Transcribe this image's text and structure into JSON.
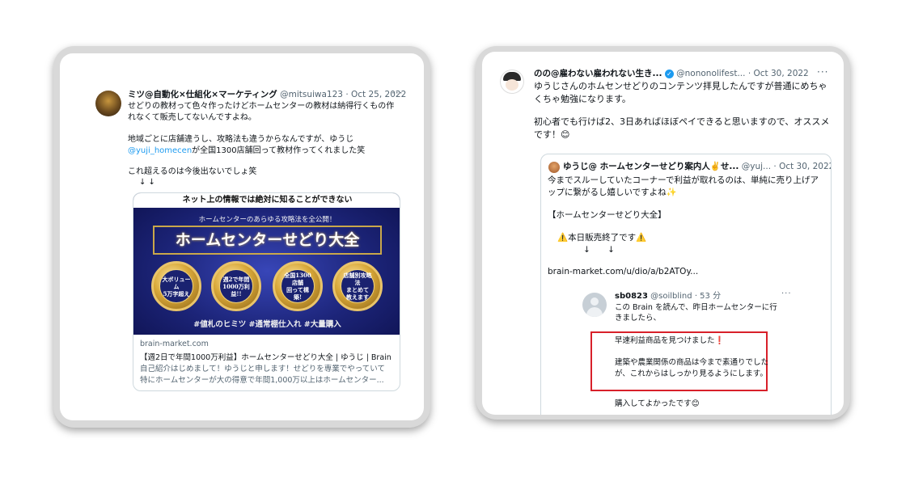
{
  "left_tweet": {
    "display_name": "ミツ@自動化×仕組化×マーケティング",
    "handle": "@mitsuiwa123",
    "date": "· Oct 25, 2022",
    "more": "···",
    "text_lines": [
      "せどりの教材って色々作ったけどホームセンターの教材は納得行くもの作",
      "れなくて販売してないんですよね。",
      "地域ごとに店舗違うし、攻略法も違うからなんですが、ゆうじ"
    ],
    "mention": "@yuji_homecen",
    "mention_rest": "が全国1300店舗回って教材作ってくれました笑",
    "text_after": "これ超えるのは今後出ないでしょ笑",
    "arrows": "↓ ↓",
    "link_card": {
      "banner_top": "ネット上の情報では絶対に知ることができない",
      "banner_sub": "ホームセンターのあらゆる攻略法を全公開！",
      "banner_title": "ホームセンターせどり大全",
      "medals": [
        "大ボリューム\n5万字超え",
        "週2で年間\n1000万利益!!",
        "全国1300店舗\n回って構築!",
        "店舗別攻略法\nまとめて\n教えます"
      ],
      "banner_bottom": "#値札のヒミツ  #通常棚仕入れ  #大量購入",
      "domain": "brain-market.com",
      "title": "【週2日で年間1000万利益】ホームセンターせどり大全 | ゆうじ | Brain",
      "desc_lines": [
        "自己紹介はじめまして！ゆうじと申します！せどりを専業でやっていて",
        "特にホームセンターが大の得意で年間1,000万以上はホームセンター..."
      ]
    }
  },
  "right_tweet": {
    "display_name": "のの@雇わない雇われない生き...",
    "handle": "@nononolifest...",
    "date": "· Oct 30, 2022",
    "more": "···",
    "text_lines": [
      "ゆうじさんのホムセンせどりのコンテンツ拝見したんですが普通にめちゃ",
      "くちゃ勉強になります。",
      "初心者でも行けば2、3日あればほぼペイできると思いますので、オススメ",
      "です！😊"
    ],
    "quote": {
      "display_name": "ゆうじ@ ホームセンターせどり案内人✌️せ...",
      "handle": "@yuj...",
      "date": "· Oct 30, 2022",
      "lines": [
        "今までスルーしていたコーナーで利益が取れるのは、単純に売り上げア",
        "ップに繋がるし嬉しいですよね✨",
        "【ホームセンターせどり大全】",
        "⚠️本日販売終了です⚠️",
        "↓ ↓",
        "brain-market.com/u/dio/a/b2ATOy..."
      ],
      "inner": {
        "name": "sb0823",
        "handle": "@soilblind",
        "time": "· 53 分",
        "more": "···",
        "lines": [
          "この Brain を読んで、昨日ホームセンターに行",
          "きましたら、",
          "早速利益商品を見つけました❗",
          "建築や農業関係の商品は今まで素通りでした",
          "が、これからはしっかり見るようにします。",
          "購入してよかったです😊"
        ]
      }
    }
  }
}
